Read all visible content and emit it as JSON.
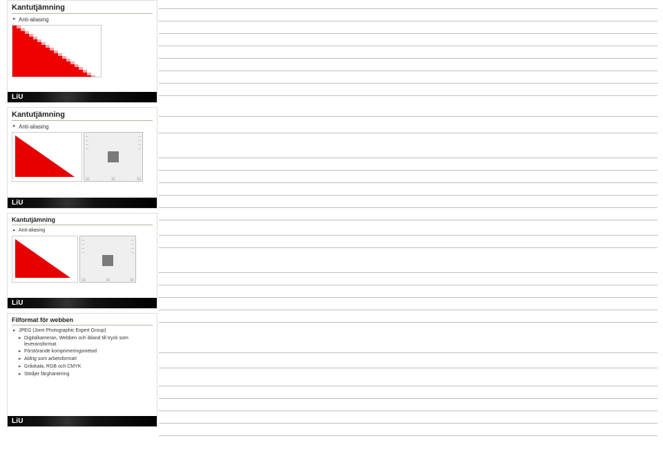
{
  "brand": "LiU",
  "slide1": {
    "title": "Kantutjämning",
    "bullet": "Anti-aliasing"
  },
  "slide2": {
    "title": "Kantutjämning",
    "bullet": "Anti-aliasing"
  },
  "slide3": {
    "title": "Kantutjämning",
    "bullet": "Anti-aliasing"
  },
  "slide4": {
    "title": "Filformat för webben",
    "b0": "JPEG (Joint Photographic Expert Group)",
    "b1": "Digitalkameran, Webben och ibland till tryck som leveransformat",
    "b2": "Förstörande komprimeringsmetod",
    "b3": "Aldrig som arbetsformat!",
    "b4": "Gråskala, RGB och CMYK",
    "b5": "Stödjer färghantering"
  },
  "line_positions": [
    12,
    30,
    48,
    66,
    84,
    102,
    120,
    138,
    168,
    192,
    228,
    246,
    264,
    282,
    300,
    318,
    340,
    358,
    394,
    412,
    430,
    448,
    466,
    510,
    532,
    558,
    576,
    594,
    612,
    630
  ]
}
